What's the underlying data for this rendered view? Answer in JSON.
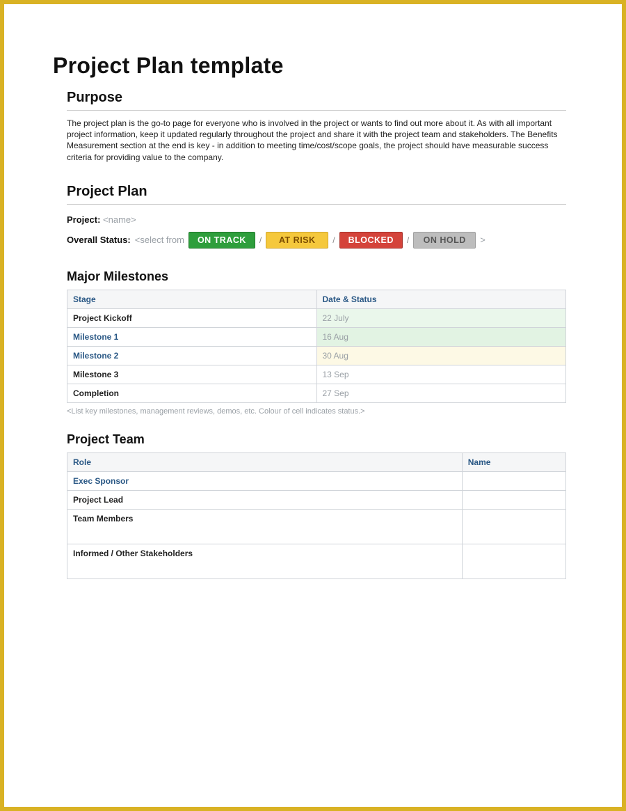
{
  "title": "Project Plan template",
  "purpose": {
    "heading": "Purpose",
    "body": "The project plan is the go-to page for everyone who is involved in the project or wants to find out more about it.   As with all important project information, keep it updated regularly throughout the project and share it with the project team and stakeholders.  The Benefits Measurement section at the end is key - in addition to meeting time/cost/scope goals, the project should have measurable success criteria for providing value to the company."
  },
  "plan": {
    "heading": "Project Plan",
    "project_label": "Project:",
    "project_placeholder": "<name>",
    "overall_status_label": "Overall Status:",
    "overall_status_hint": "<select from",
    "statuses": {
      "on_track": "ON TRACK",
      "at_risk": "AT RISK",
      "blocked": "BLOCKED",
      "on_hold": "ON HOLD"
    },
    "close_hint": ">"
  },
  "milestones": {
    "heading": "Major Milestones",
    "col_stage": "Stage",
    "col_date": "Date & Status",
    "rows": [
      {
        "stage": "Project Kickoff",
        "date": "22 July",
        "style": "bold",
        "row": "green"
      },
      {
        "stage": "Milestone 1",
        "date": "16 Aug",
        "style": "link",
        "row": "green2"
      },
      {
        "stage": "Milestone 2",
        "date": "30 Aug",
        "style": "link",
        "row": "yellow"
      },
      {
        "stage": "Milestone 3",
        "date": "13 Sep",
        "style": "bold",
        "row": "plain"
      },
      {
        "stage": "Completion",
        "date": "27 Sep",
        "style": "bold",
        "row": "plain"
      }
    ],
    "note": "<List key milestones, management reviews, demos, etc.  Colour of cell indicates status.>"
  },
  "team": {
    "heading": "Project Team",
    "col_role": "Role",
    "col_name": "Name",
    "rows": [
      {
        "role": "Exec Sponsor",
        "style": "link",
        "tall": false
      },
      {
        "role": "Project Lead",
        "style": "bold",
        "tall": false
      },
      {
        "role": "Team Members",
        "style": "bold",
        "tall": true
      },
      {
        "role": "Informed / Other Stakeholders",
        "style": "bold",
        "tall": true
      }
    ]
  },
  "footer": ""
}
